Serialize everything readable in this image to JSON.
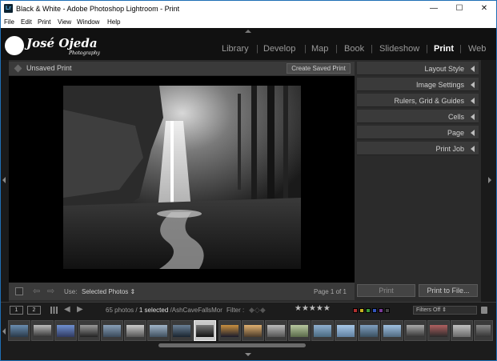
{
  "window": {
    "title": "Black & White - Adobe Photoshop Lightroom - Print",
    "app_icon": "Lr",
    "controls": {
      "minimize": "—",
      "maximize": "☐",
      "close": "✕"
    }
  },
  "menu": [
    "File",
    "Edit",
    "Print",
    "View",
    "Window",
    "Help"
  ],
  "identity_plate": {
    "name": "José Ojeda",
    "tagline": "Photography"
  },
  "modules": [
    "Library",
    "Develop",
    "Map",
    "Book",
    "Slideshow",
    "Print",
    "Web"
  ],
  "active_module": "Print",
  "center": {
    "title": "Unsaved Print",
    "create_saved_print": "Create Saved Print",
    "use_label": "Use:",
    "use_value": "Selected Photos ⇕",
    "page_indicator": "Page 1 of 1"
  },
  "right_panel": {
    "sections": [
      "Layout Style",
      "Image Settings",
      "Rulers, Grid & Guides",
      "Cells",
      "Page",
      "Print Job"
    ],
    "print_button": "Print",
    "print_to_file_button": "Print to File..."
  },
  "filmstrip_toolbar": {
    "screen1": "1",
    "screen2": "2",
    "count": "65 photos /",
    "selected": "1 selected",
    "filename": "/AshCaveFallsMor",
    "filter_label": "Filter :",
    "stars": "★★★★★",
    "filters_off": "Filters Off ⇕"
  },
  "colors": {
    "accent_active": "#ffffff",
    "label_red": "#b03030",
    "label_yellow": "#c8b020",
    "label_green": "#3a9a3a",
    "label_blue": "#3355bb",
    "label_purple": "#7a3a9a"
  }
}
